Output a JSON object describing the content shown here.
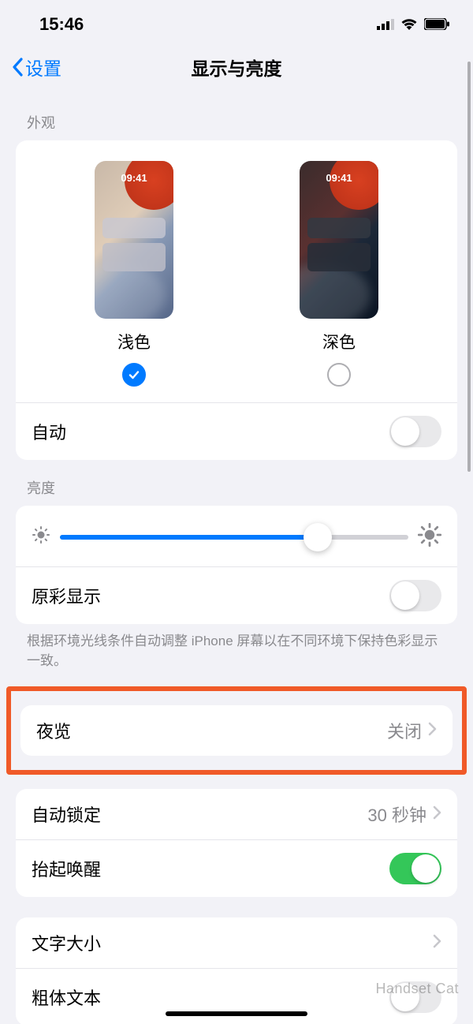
{
  "status": {
    "time": "15:46"
  },
  "nav": {
    "back": "设置",
    "title": "显示与亮度"
  },
  "appearance": {
    "header": "外观",
    "light_label": "浅色",
    "dark_label": "深色",
    "preview_time": "09:41",
    "selected": "light",
    "auto_label": "自动",
    "auto_on": false
  },
  "brightness": {
    "header": "亮度",
    "value_pct": 74,
    "truetone_label": "原彩显示",
    "truetone_on": false,
    "truetone_footer": "根据环境光线条件自动调整 iPhone 屏幕以在不同环境下保持色彩显示一致。"
  },
  "nightshift": {
    "label": "夜览",
    "value": "关闭"
  },
  "lock": {
    "auto_lock_label": "自动锁定",
    "auto_lock_value": "30 秒钟",
    "raise_label": "抬起唤醒",
    "raise_on": true
  },
  "text": {
    "size_label": "文字大小",
    "bold_label": "粗体文本",
    "bold_on": false
  },
  "watermark": "Handset Cat"
}
